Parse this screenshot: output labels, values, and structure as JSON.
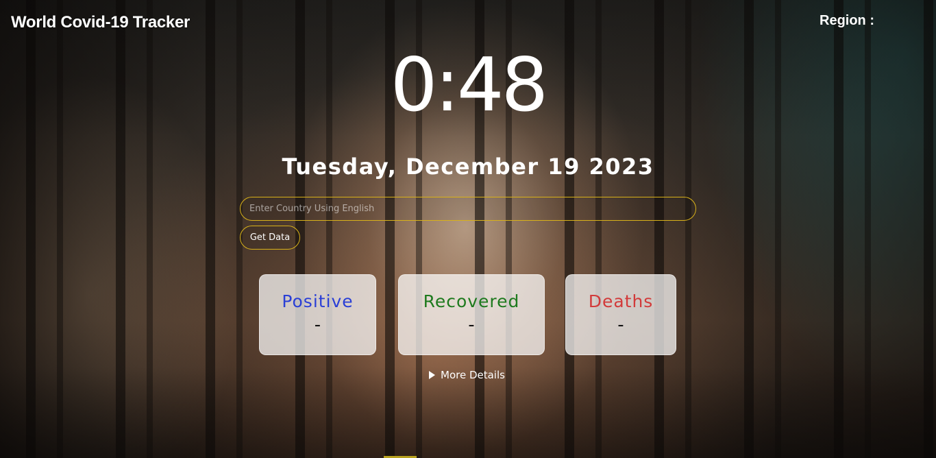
{
  "header": {
    "title": "World Covid-19 Tracker",
    "region_label": "Region :"
  },
  "clock": {
    "time": "0:48",
    "date": "Tuesday, December 19 2023"
  },
  "search": {
    "placeholder": "Enter Country Using English",
    "value": "",
    "button_label": "Get Data"
  },
  "stats": {
    "positive": {
      "label": "Positive",
      "value": "-",
      "color": "#2a3fd6"
    },
    "recovered": {
      "label": "Recovered",
      "value": "-",
      "color": "#1e7a1e"
    },
    "deaths": {
      "label": "Deaths",
      "value": "-",
      "color": "#d23a3a"
    }
  },
  "details": {
    "toggle_label": "More Details"
  },
  "theme": {
    "accent": "#d9b21a"
  }
}
